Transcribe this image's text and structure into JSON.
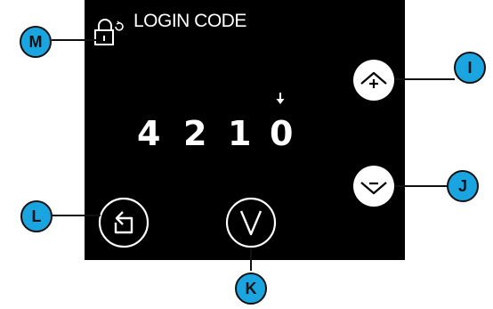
{
  "screen": {
    "title": "LOGIN CODE",
    "code_digits": [
      "4",
      "2",
      "1",
      "0"
    ]
  },
  "icons": {
    "lock": "lock-refresh-icon",
    "cursor": "down-arrow-icon",
    "increment": "chevron-up-plus-icon",
    "decrement": "chevron-down-minus-icon",
    "back": "back-arrow-icon",
    "confirm": "checkmark-icon"
  },
  "callouts": {
    "I": "I",
    "J": "J",
    "K": "K",
    "L": "L",
    "M": "M"
  },
  "colors": {
    "screen_bg": "#000000",
    "screen_fg": "#ffffff",
    "callout_fill": "#1ba5e0",
    "callout_border": "#111111"
  }
}
